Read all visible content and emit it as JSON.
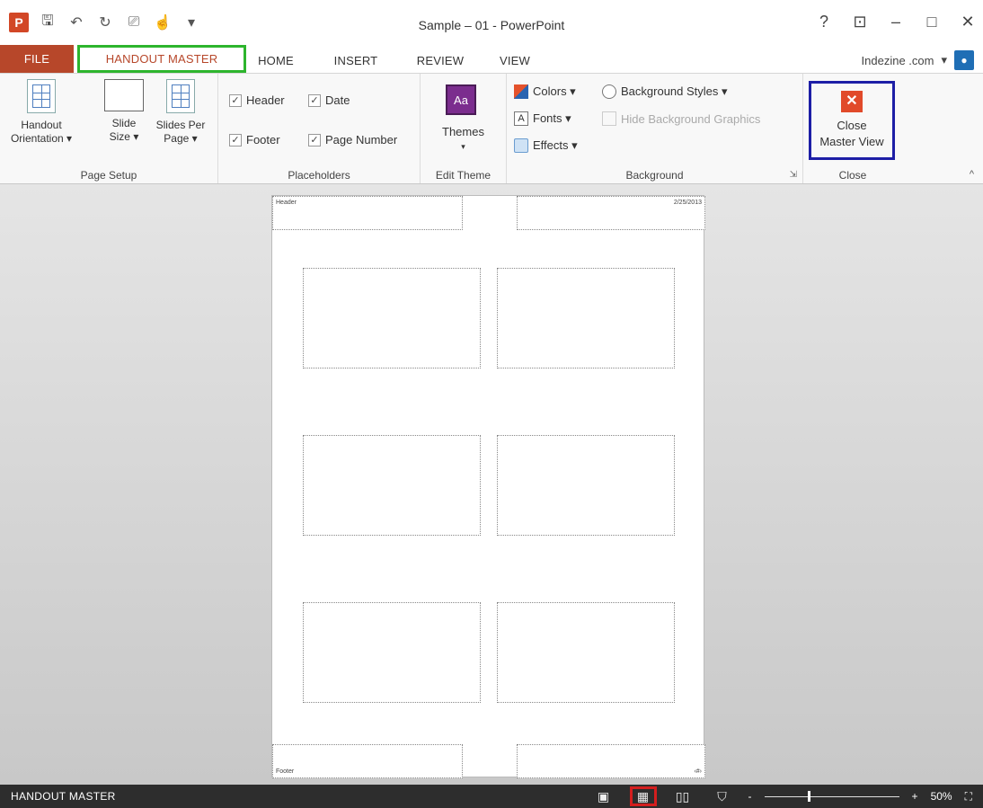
{
  "window": {
    "title": "Sample – 01 - PowerPoint",
    "controls": {
      "help": "?",
      "ribbon_options": "⊡",
      "minimize": "–",
      "maximize": "□",
      "close": "✕"
    }
  },
  "qat": {
    "app_icon": "P",
    "save": "🖫",
    "undo": "↶",
    "redo": "↻",
    "present": "⎚",
    "touch": "☝",
    "customize": "▾"
  },
  "tabs": {
    "file": "FILE",
    "handout_master": "HANDOUT MASTER",
    "home": "HOME",
    "insert": "INSERT",
    "review": "REVIEW",
    "view": "VIEW"
  },
  "account": {
    "name": "Indezine .com",
    "dropdown": "▾"
  },
  "ribbon": {
    "page_setup": {
      "label": "Page Setup",
      "orientation": "Handout\nOrientation ▾",
      "slide_size": "Slide\nSize ▾",
      "slides_per_page": "Slides Per\nPage ▾"
    },
    "placeholders": {
      "label": "Placeholders",
      "header": "Header",
      "date": "Date",
      "footer": "Footer",
      "page_number": "Page Number",
      "check": "✓"
    },
    "edit_theme": {
      "label": "Edit Theme",
      "themes": "Themes",
      "themes_icon": "Aa",
      "arrow": "▾"
    },
    "background": {
      "label": "Background",
      "colors": "Colors ▾",
      "fonts": "Fonts ▾",
      "fonts_icon": "A",
      "effects": "Effects ▾",
      "background_styles": "Background Styles ▾",
      "hide_graphics": "Hide Background Graphics",
      "launcher": "⇲"
    },
    "close": {
      "label": "Close",
      "close_master": "Close\nMaster View",
      "close_icon": "✕"
    },
    "collapse": "^"
  },
  "handout_page": {
    "header": "Header",
    "date": "2/25/2013",
    "footer": "Footer",
    "page_number": "‹#›"
  },
  "status": {
    "mode": "HANDOUT MASTER",
    "view_normal": "▣",
    "view_sorter": "▦",
    "view_reading": "▯▯",
    "view_slideshow": "⛉",
    "zoom_out": "-",
    "zoom_in": "+",
    "zoom_percent": "50%",
    "zoom_level": 0.5,
    "fit": "⛶"
  }
}
